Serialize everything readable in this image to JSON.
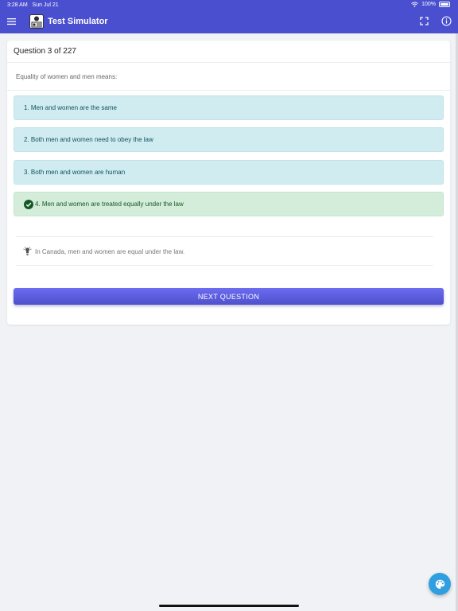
{
  "status_bar": {
    "time": "3:28 AM",
    "date": "Sun Jul 21",
    "battery": "100%",
    "wifi_icon": "wifi-icon"
  },
  "app_bar": {
    "title": "Test Simulator",
    "menu_icon": "menu-icon",
    "fullscreen_icon": "fullscreen-icon",
    "info_icon": "info-icon"
  },
  "question": {
    "counter": "Question 3 of 227",
    "text": "Equality of women and men means:",
    "answers": [
      {
        "label": "1. Men and women are the same",
        "correct": false
      },
      {
        "label": "2. Both men and women need to obey the law",
        "correct": false
      },
      {
        "label": "3. Both men and women are human",
        "correct": false
      },
      {
        "label": "4. Men and women are treated equally under the law",
        "correct": true
      }
    ],
    "hint": "In Canada, men and women are equal under the law."
  },
  "actions": {
    "next_label": "NEXT QUESTION"
  },
  "colors": {
    "primary": "#4a4fcf",
    "button": "#5d5ee0",
    "answer_bg": "#d1ecf1",
    "correct_bg": "#d4edda",
    "fab": "#2f9fe0"
  }
}
